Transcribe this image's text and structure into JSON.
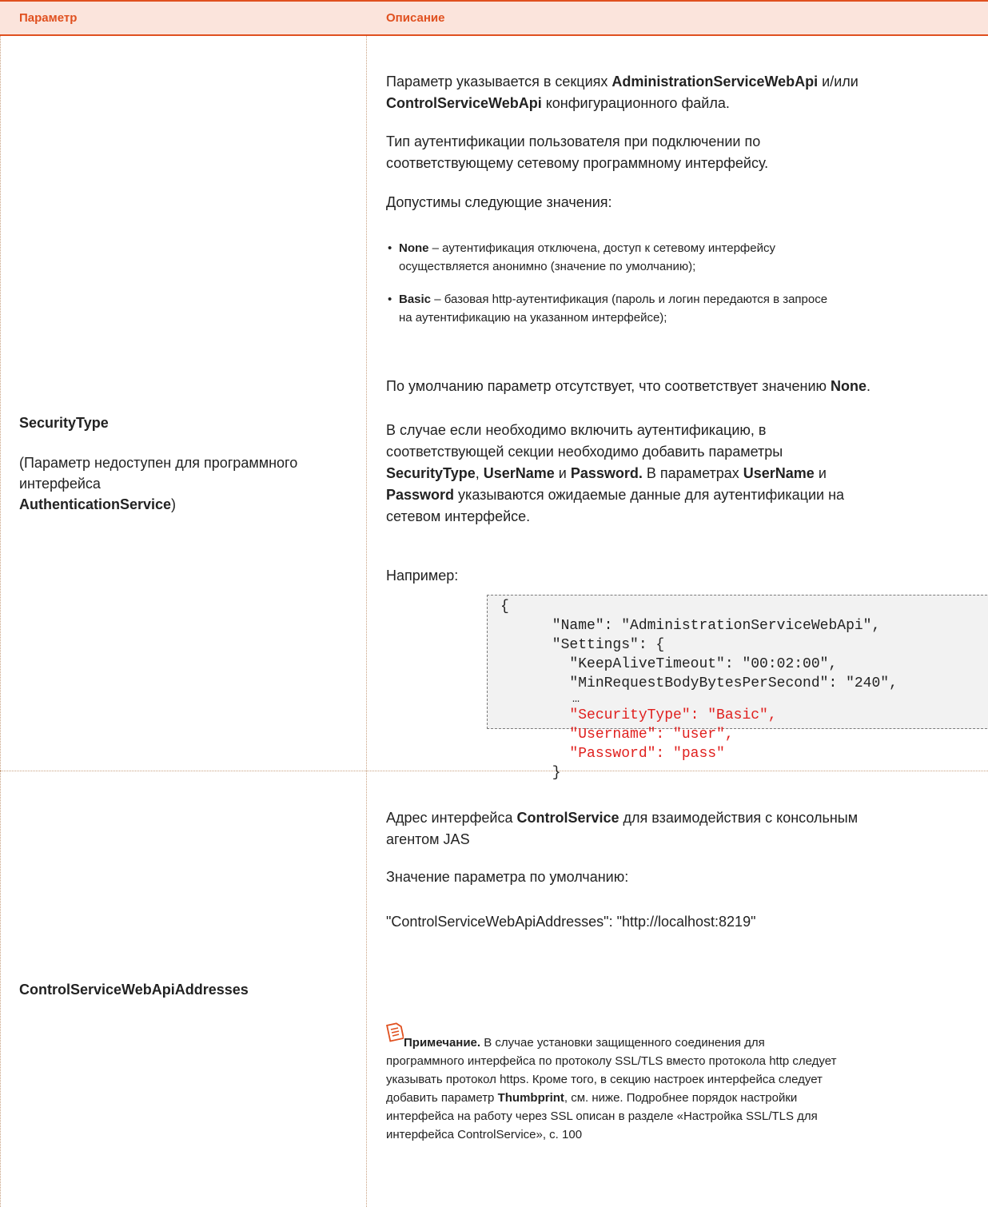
{
  "table": {
    "headers": {
      "parameter": "Параметр",
      "description": "Описание"
    }
  },
  "row1": {
    "param_name": "SecurityType",
    "param_note_prefix": "(Параметр недоступен для программного интерфейса",
    "param_note_bold": "AuthenticationService",
    "param_note_suffix": ")",
    "p1_a": "Параметр указывается в секциях ",
    "p1_b": "AdministrationServiceWebApi",
    "p1_c": " и/или",
    "p1_d": "ControlServiceWebApi",
    "p1_e": " конфигурационного файла.",
    "p2_line1": "Тип аутентификации пользователя при подключении по",
    "p2_line2": "соответствующему сетевому программному интерфейсу.",
    "p3": "Допустимы следующие значения:",
    "bullet1_bold": "None",
    "bullet1_line1": " – аутентификация отключена, доступ к сетевому интерфейсу",
    "bullet1_line2": "осуществляется анонимно (значение по умолчанию);",
    "bullet2_bold": "Basic",
    "bullet2_line1": " – базовая http-аутентификация (пароль и логин передаются в запросе",
    "bullet2_line2": "на аутентификацию на указанном интерфейсе);",
    "p4_a": "По умолчанию параметр отсутствует, что соответствует значению ",
    "p4_b": "None",
    "p4_c": ".",
    "p5_line1": "В случае если необходимо включить аутентификацию, в",
    "p5_line2": "соответствующей секции необходимо добавить параметры",
    "p5_b1": "SecurityType",
    "p5_t1": ", ",
    "p5_b2": "UserName",
    "p5_t2": " и ",
    "p5_b3": "Password.",
    "p5_t3": " В параметрах ",
    "p5_b4": "UserName",
    "p5_t4": " и",
    "p5_b5": "Password",
    "p5_t5": " указываются ожидаемые данные для аутентификации на",
    "p5_line5": "сетевом интерфейсе.",
    "p6": "Например:",
    "code_lines": [
      "{",
      "      \"Name\": \"AdministrationServiceWebApi\",",
      "      \"Settings\": {",
      "        \"KeepAliveTimeout\": \"00:02:00\",",
      "        \"MinRequestBodyBytesPerSecond\": \"240\",",
      "          …",
      "        \"SecurityType\": \"Basic\",",
      "        \"Username\": \"user\",",
      "        \"Password\": \"pass\"",
      "      }"
    ]
  },
  "row2": {
    "param_name": "ControlServiceWebApiAddresses",
    "p1_a": "Адрес интерфейса ",
    "p1_b": "ControlService",
    "p1_c": " для взаимодействия с консольным",
    "p1_line2": "агентом JAS",
    "p2": "Значение параметра по умолчанию:",
    "p3": "\"ControlServiceWebApiAddresses\": \"http://localhost:8219\"",
    "note_label": "Примечание.",
    "note_line1": " В случае установки защищенного соединения для",
    "note_line2": "программного интерфейса по протоколу SSL/TLS вместо протокола http следует",
    "note_line3": "указывать протокол https. Кроме того, в секцию настроек интерфейса следует",
    "note_line4_a": "добавить параметр ",
    "note_line4_b": "Thumbprint",
    "note_line4_c": ", см. ниже. Подробнее порядок настройки",
    "note_line5": "интерфейса на работу через SSL описан в разделе «Настройка SSL/TLS для",
    "note_line6": "интерфейса ControlService», с. 100"
  },
  "colors": {
    "accent": "#e0501f",
    "header_bg": "#fbe4dc",
    "code_red": "#e0201e",
    "code_bg": "#f2f2f2"
  },
  "icons": {
    "note": "note-icon"
  }
}
